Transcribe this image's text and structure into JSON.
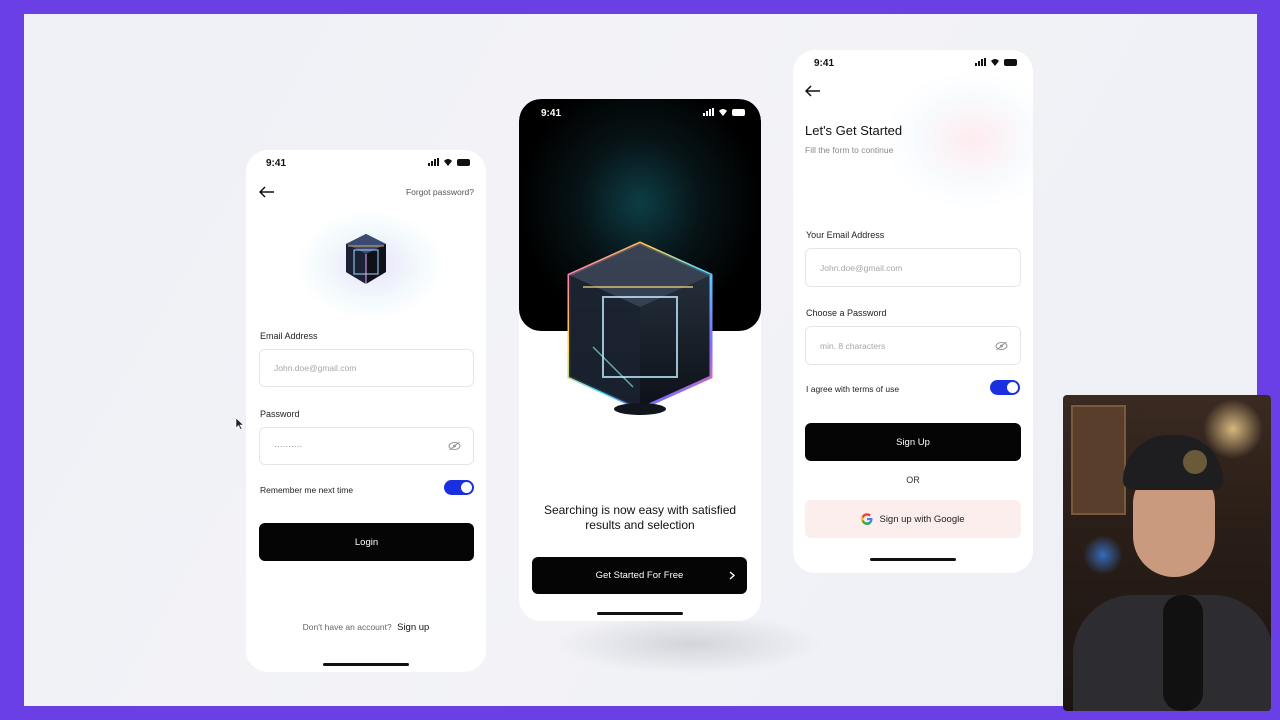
{
  "login_screen": {
    "status_time": "9:41",
    "forgot_password": "Forgot password?",
    "email_label": "Email Address",
    "email_placeholder": "John.doe@gmail.com",
    "password_label": "Password",
    "password_value": "··········",
    "remember_label": "Remember me next time",
    "remember_on": true,
    "login_button": "Login",
    "no_account_text": "Don't have an account?",
    "signup_link": "Sign up"
  },
  "onboarding_screen": {
    "status_time": "9:41",
    "headline": "Searching is now easy with satisfied results and selection",
    "cta_button": "Get Started For Free"
  },
  "signup_screen": {
    "status_time": "9:41",
    "title": "Let's Get Started",
    "subtitle": "Fill the form to continue",
    "email_label": "Your Email Address",
    "email_placeholder": "John.doe@gmail.com",
    "password_label": "Choose a Password",
    "password_placeholder": "min. 8 characters",
    "terms_label": "I agree with terms of use",
    "terms_on": true,
    "signup_button": "Sign Up",
    "or_text": "OR",
    "google_button": "Sign up with Google"
  },
  "colors": {
    "frame": "#6b3fe6",
    "toggle": "#1a2fe0",
    "button": "#050505",
    "google_button_bg": "#fdeeee"
  }
}
